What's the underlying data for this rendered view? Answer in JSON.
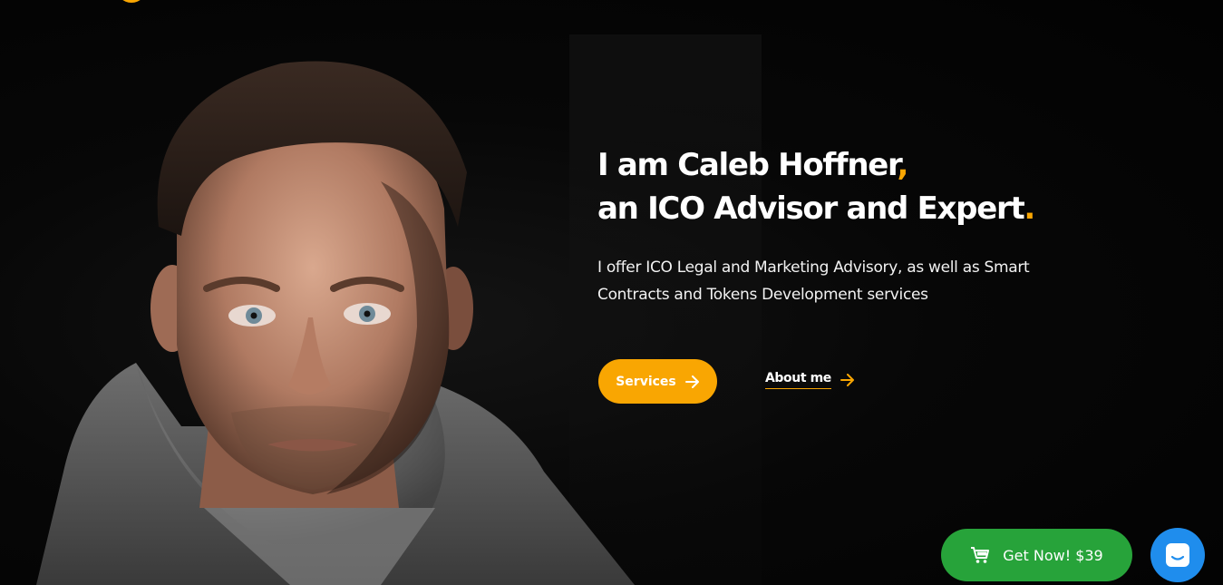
{
  "hero": {
    "headline_line1": "I am Caleb Hoffner",
    "headline_comma": ",",
    "headline_line2": "an ICO Advisor and Expert",
    "headline_period": ".",
    "lead": "I offer ICO Legal and Marketing Advisory, as well as Smart Contracts and Tokens Development services",
    "portrait_alt": "Portrait of Caleb Hoffner"
  },
  "actions": {
    "services_label": "Services",
    "about_label": "About me"
  },
  "floating": {
    "get_now_label": "Get Now! $39"
  },
  "icons": {
    "arrow": "arrow-right-icon",
    "cart": "cart-icon",
    "chat": "chat-icon",
    "logo": "logo-mark"
  },
  "colors": {
    "accent": "#f9a602",
    "background": "#050505",
    "get_now_green": "#27a33a",
    "chat_blue": "#1f8ded"
  }
}
